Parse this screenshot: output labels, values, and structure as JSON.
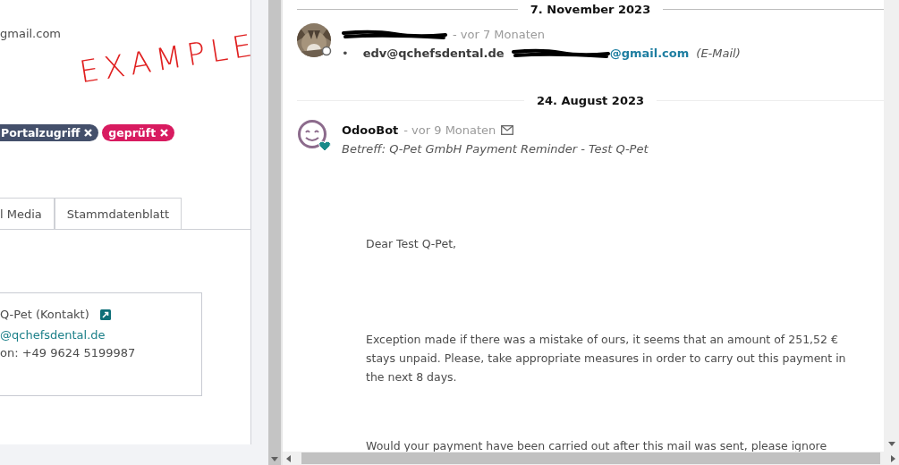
{
  "partner_panel": {
    "email_fragment": "gmail.com",
    "annotation": "EXAMPLE",
    "tags": [
      {
        "label": "Portalzugriff",
        "color": "#44506b"
      },
      {
        "label": "geprüft",
        "color": "#d81b60"
      }
    ],
    "tabs": [
      {
        "label": "l Media"
      },
      {
        "label": "Stammdatenblatt"
      }
    ],
    "contact_card": {
      "name": "Q-Pet (Kontakt)",
      "email": "@qchefsdental.de",
      "phone": "on: +49 9624 5199987"
    }
  },
  "chatter": {
    "groups": [
      {
        "date": "7. November 2023",
        "messages": [
          {
            "kind": "recipients",
            "author_redacted": true,
            "time": "- vor 7 Monaten",
            "bullet": "•",
            "from": "edv@qchefsdental.de",
            "to": "@gmail.com",
            "to_redacted": true,
            "note": "(E-Mail)"
          }
        ]
      },
      {
        "date": "24. August 2023",
        "messages": [
          {
            "kind": "email",
            "author": "OdooBot",
            "time": "- vor 9 Monaten",
            "subject": "Betreff: Q-Pet GmbH Payment Reminder - Test Q-Pet",
            "body": [
              "Dear Test Q-Pet,",
              "Exception made if there was a mistake of ours, it seems that an amount of 251,52 € stays unpaid. Please, take appropriate measures in order to carry out this payment in the next 8 days.",
              "Would your payment have been carried out after this mail was sent, please ignore"
            ]
          }
        ]
      }
    ]
  }
}
